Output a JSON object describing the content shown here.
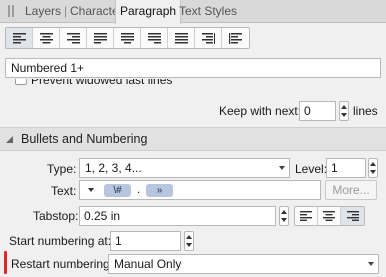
{
  "tabs": [
    {
      "label": "Layers"
    },
    {
      "label": "Character"
    },
    {
      "label": "Paragraph"
    },
    {
      "label": "Text Styles"
    }
  ],
  "alignment": {
    "options": [
      "align-left",
      "align-center",
      "align-right",
      "justify-left",
      "justify-center",
      "justify-right",
      "justify-all",
      "align-towards-spine",
      "align-away-from-spine"
    ],
    "selected": "align-left"
  },
  "paragraph_style": {
    "value": "Numbered 1+"
  },
  "widow": {
    "label": "Prevent widowed last lines"
  },
  "keep_with_next": {
    "label": "Keep with next:",
    "value": "0",
    "unit": "lines"
  },
  "section": {
    "title": "Bullets and Numbering"
  },
  "type_field": {
    "label": "Type:",
    "value": "1, 2, 3, 4..."
  },
  "level_field": {
    "label": "Level:",
    "value": "1"
  },
  "text_field": {
    "label": "Text:",
    "tokens": [
      "\\#",
      "»"
    ],
    "separator": "."
  },
  "more_button": {
    "label": "More..."
  },
  "tabstop_field": {
    "label": "Tabstop:",
    "value": "0.25 in",
    "alignment_selected": "right"
  },
  "start_numbering": {
    "label": "Start numbering at:",
    "value": "1"
  },
  "restart_numbering": {
    "label": "Restart numbering:",
    "value": "Manual Only"
  },
  "colors": {
    "accent_marker": "#e0262a",
    "token_bg": "#b7c6de",
    "active_tab_bg": "#f0f0f0"
  }
}
